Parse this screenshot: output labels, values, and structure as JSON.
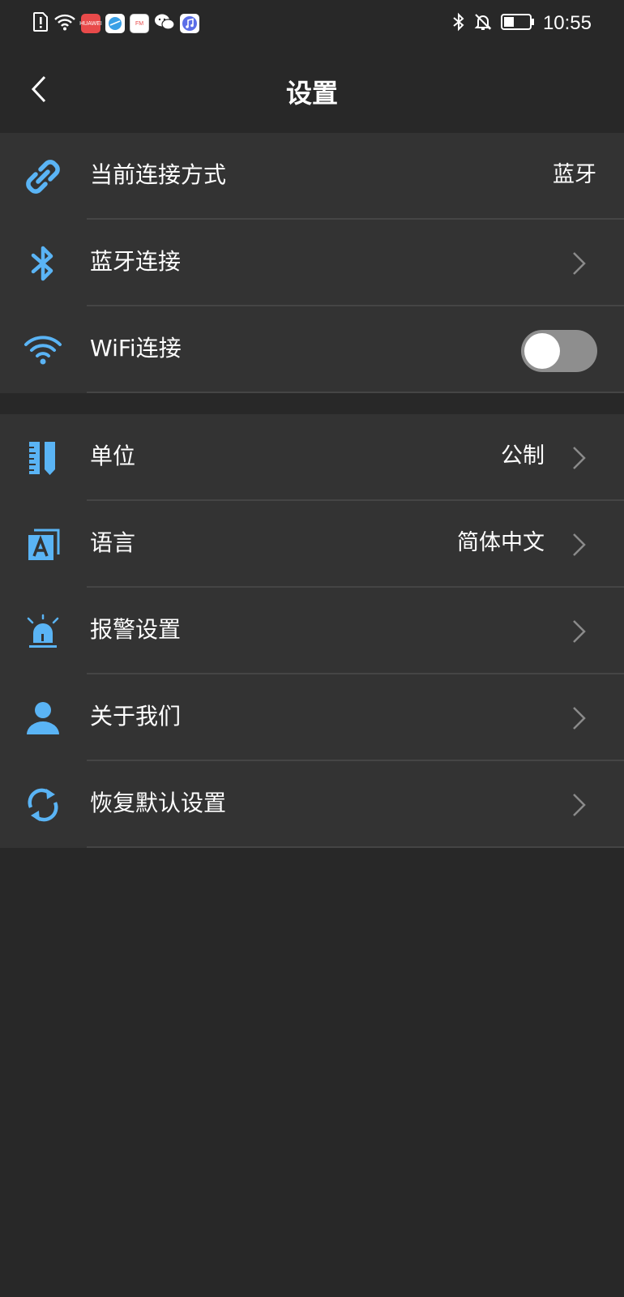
{
  "status_bar": {
    "time": "10:55",
    "apps": [
      {
        "icon": "huawei-app-icon",
        "label": "HUAWEI",
        "color": "#e84a4a"
      },
      {
        "icon": "browser-app-icon",
        "label": "",
        "color": "#3aa0e6"
      },
      {
        "icon": "fm-app-icon",
        "label": "FM",
        "color": "#ffffff"
      },
      {
        "icon": "wechat-app-icon",
        "label": "",
        "color": "#ffffff"
      },
      {
        "icon": "music-app-icon",
        "label": "",
        "color": "#5b6ee8"
      }
    ],
    "battery_level": 0.35
  },
  "nav": {
    "title": "设置",
    "back_icon": "chevron-left-icon"
  },
  "colors": {
    "background": "#282828",
    "group_background": "#333333",
    "accent_icon": "#5ab4f5",
    "toggle_off": "#8e8e8e"
  },
  "settings": {
    "connection_mode": {
      "label": "当前连接方式",
      "value": "蓝牙",
      "icon": "link-icon"
    },
    "bluetooth": {
      "label": "蓝牙连接",
      "icon": "bluetooth-icon"
    },
    "wifi": {
      "label": "WiFi连接",
      "icon": "wifi-icon",
      "enabled": false
    },
    "unit": {
      "label": "单位",
      "value": "公制",
      "icon": "ruler-pencil-icon"
    },
    "language": {
      "label": "语言",
      "value": "简体中文",
      "icon": "language-icon"
    },
    "alarm": {
      "label": "报警设置",
      "icon": "siren-icon"
    },
    "about": {
      "label": "关于我们",
      "icon": "person-icon"
    },
    "reset": {
      "label": "恢复默认设置",
      "icon": "refresh-icon"
    }
  }
}
